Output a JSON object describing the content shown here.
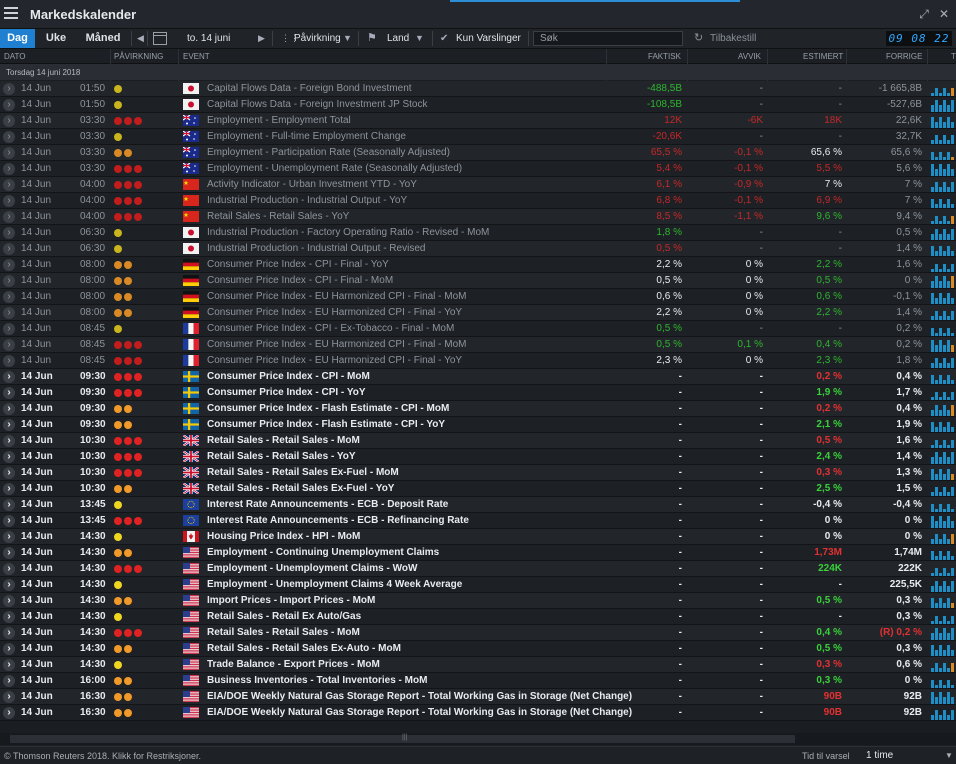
{
  "app": {
    "title": "Markedskalender"
  },
  "toolbar": {
    "tabs": [
      "Dag",
      "Uke",
      "Måned"
    ],
    "date_label": "to. 14 juni",
    "filter_impact": "Påvirkning",
    "filter_country": "Land",
    "alerts_only": "Kun Varslinger",
    "search_placeholder": "Søk",
    "reset": "Tilbakestill",
    "clock": "09 08 22"
  },
  "columns": {
    "date": "DATO",
    "impact": "PÅVIRKNING",
    "event": "EVENT",
    "actual": "FAKTISK",
    "deviation": "AVVIK",
    "estimate": "ESTIMERT",
    "previous": "FORRIGE",
    "trend": "T"
  },
  "group_label": "Torsdag 14 juni 2018",
  "rows": [
    {
      "date": "14 Jun",
      "time": "01:50",
      "impact": "y",
      "country": "JP",
      "event": "Capital Flows Data - Foreign Bond Investment",
      "actual": "-488,5B",
      "ac": "green",
      "dev": "-",
      "dc": "",
      "est": "-",
      "ec": "",
      "prev": "-1 665,8B",
      "state": "past"
    },
    {
      "date": "14 Jun",
      "time": "01:50",
      "impact": "y",
      "country": "JP",
      "event": "Capital Flows Data - Foreign Investment JP Stock",
      "actual": "-108,5B",
      "ac": "green",
      "dev": "-",
      "dc": "",
      "est": "-",
      "ec": "",
      "prev": "-527,6B",
      "state": "past"
    },
    {
      "date": "14 Jun",
      "time": "03:30",
      "impact": "rrr",
      "country": "AU",
      "event": "Employment - Employment Total",
      "actual": "12K",
      "ac": "red",
      "dev": "-6K",
      "dc": "red",
      "est": "18K",
      "ec": "red",
      "prev": "22,6K",
      "state": "past"
    },
    {
      "date": "14 Jun",
      "time": "03:30",
      "impact": "y",
      "country": "AU",
      "event": "Employment - Full-time Employment Change",
      "actual": "-20,6K",
      "ac": "red",
      "dev": "-",
      "dc": "",
      "est": "-",
      "ec": "",
      "prev": "32,7K",
      "state": "past"
    },
    {
      "date": "14 Jun",
      "time": "03:30",
      "impact": "oo",
      "country": "AU",
      "event": "Employment - Participation Rate (Seasonally Adjusted)",
      "actual": "65,5 %",
      "ac": "red",
      "dev": "-0,1 %",
      "dc": "red",
      "est": "65,6 %",
      "ec": "white",
      "prev": "65,6 %",
      "state": "past"
    },
    {
      "date": "14 Jun",
      "time": "03:30",
      "impact": "rrr",
      "country": "AU",
      "event": "Employment - Unemployment Rate (Seasonally Adjusted)",
      "actual": "5,4 %",
      "ac": "red",
      "dev": "-0,1 %",
      "dc": "red",
      "est": "5,5 %",
      "ec": "red",
      "prev": "5,6 %",
      "state": "past"
    },
    {
      "date": "14 Jun",
      "time": "04:00",
      "impact": "rrr",
      "country": "CN",
      "event": "Activity Indicator - Urban Investment YTD - YoY",
      "actual": "6,1 %",
      "ac": "red",
      "dev": "-0,9 %",
      "dc": "red",
      "est": "7 %",
      "ec": "white",
      "prev": "7 %",
      "state": "past"
    },
    {
      "date": "14 Jun",
      "time": "04:00",
      "impact": "rrr",
      "country": "CN",
      "event": "Industrial Production - Industrial Output - YoY",
      "actual": "6,8 %",
      "ac": "red",
      "dev": "-0,1 %",
      "dc": "red",
      "est": "6,9 %",
      "ec": "red",
      "prev": "7 %",
      "state": "past"
    },
    {
      "date": "14 Jun",
      "time": "04:00",
      "impact": "rrr",
      "country": "CN",
      "event": "Retail Sales - Retail Sales - YoY",
      "actual": "8,5 %",
      "ac": "red",
      "dev": "-1,1 %",
      "dc": "red",
      "est": "9,6 %",
      "ec": "green",
      "prev": "9,4 %",
      "state": "past"
    },
    {
      "date": "14 Jun",
      "time": "06:30",
      "impact": "y",
      "country": "JP",
      "event": "Industrial Production - Factory Operating Ratio - Revised - MoM",
      "actual": "1,8 %",
      "ac": "green",
      "dev": "-",
      "dc": "",
      "est": "-",
      "ec": "",
      "prev": "0,5 %",
      "state": "past"
    },
    {
      "date": "14 Jun",
      "time": "06:30",
      "impact": "y",
      "country": "JP",
      "event": "Industrial Production - Industrial Output - Revised",
      "actual": "0,5 %",
      "ac": "red",
      "dev": "-",
      "dc": "",
      "est": "-",
      "ec": "",
      "prev": "1,4 %",
      "state": "past"
    },
    {
      "date": "14 Jun",
      "time": "08:00",
      "impact": "oo",
      "country": "DE",
      "event": "Consumer Price Index - CPI - Final - YoY",
      "actual": "2,2 %",
      "ac": "white",
      "dev": "0 %",
      "dc": "white",
      "est": "2,2 %",
      "ec": "green",
      "prev": "1,6 %",
      "state": "past"
    },
    {
      "date": "14 Jun",
      "time": "08:00",
      "impact": "oo",
      "country": "DE",
      "event": "Consumer Price Index - CPI - Final - MoM",
      "actual": "0,5 %",
      "ac": "white",
      "dev": "0 %",
      "dc": "white",
      "est": "0,5 %",
      "ec": "green",
      "prev": "0 %",
      "state": "past"
    },
    {
      "date": "14 Jun",
      "time": "08:00",
      "impact": "oo",
      "country": "DE",
      "event": "Consumer Price Index - EU Harmonized CPI - Final - MoM",
      "actual": "0,6 %",
      "ac": "white",
      "dev": "0 %",
      "dc": "white",
      "est": "0,6 %",
      "ec": "green",
      "prev": "-0,1 %",
      "state": "past"
    },
    {
      "date": "14 Jun",
      "time": "08:00",
      "impact": "oo",
      "country": "DE",
      "event": "Consumer Price Index - EU Harmonized CPI - Final - YoY",
      "actual": "2,2 %",
      "ac": "white",
      "dev": "0 %",
      "dc": "white",
      "est": "2,2 %",
      "ec": "green",
      "prev": "1,4 %",
      "state": "past"
    },
    {
      "date": "14 Jun",
      "time": "08:45",
      "impact": "y",
      "country": "FR",
      "event": "Consumer Price Index - CPI - Ex-Tobacco - Final - MoM",
      "actual": "0,5 %",
      "ac": "green",
      "dev": "-",
      "dc": "",
      "est": "-",
      "ec": "",
      "prev": "0,2 %",
      "state": "past"
    },
    {
      "date": "14 Jun",
      "time": "08:45",
      "impact": "rrr",
      "country": "FR",
      "event": "Consumer Price Index - EU Harmonized CPI - Final - MoM",
      "actual": "0,5 %",
      "ac": "green",
      "dev": "0,1 %",
      "dc": "green",
      "est": "0,4 %",
      "ec": "green",
      "prev": "0,2 %",
      "state": "past"
    },
    {
      "date": "14 Jun",
      "time": "08:45",
      "impact": "rrr",
      "country": "FR",
      "event": "Consumer Price Index - EU Harmonized CPI - Final - YoY",
      "actual": "2,3 %",
      "ac": "white",
      "dev": "0 %",
      "dc": "white",
      "est": "2,3 %",
      "ec": "green",
      "prev": "1,8 %",
      "state": "past"
    },
    {
      "date": "14 Jun",
      "time": "09:30",
      "impact": "rrr",
      "country": "SE",
      "event": "Consumer Price Index - CPI - MoM",
      "actual": "-",
      "ac": "",
      "dev": "-",
      "dc": "",
      "est": "0,2 %",
      "ec": "red",
      "prev": "0,4 %",
      "state": "future"
    },
    {
      "date": "14 Jun",
      "time": "09:30",
      "impact": "rrr",
      "country": "SE",
      "event": "Consumer Price Index - CPI - YoY",
      "actual": "-",
      "ac": "",
      "dev": "-",
      "dc": "",
      "est": "1,9 %",
      "ec": "green",
      "prev": "1,7 %",
      "state": "future"
    },
    {
      "date": "14 Jun",
      "time": "09:30",
      "impact": "oo",
      "country": "SE",
      "event": "Consumer Price Index - Flash Estimate - CPI - MoM",
      "actual": "-",
      "ac": "",
      "dev": "-",
      "dc": "",
      "est": "0,2 %",
      "ec": "red",
      "prev": "0,4 %",
      "state": "future"
    },
    {
      "date": "14 Jun",
      "time": "09:30",
      "impact": "oo",
      "country": "SE",
      "event": "Consumer Price Index - Flash Estimate - CPI - YoY",
      "actual": "-",
      "ac": "",
      "dev": "-",
      "dc": "",
      "est": "2,1 %",
      "ec": "green",
      "prev": "1,9 %",
      "state": "future"
    },
    {
      "date": "14 Jun",
      "time": "10:30",
      "impact": "rrr",
      "country": "GB",
      "event": "Retail Sales - Retail Sales - MoM",
      "actual": "-",
      "ac": "",
      "dev": "-",
      "dc": "",
      "est": "0,5 %",
      "ec": "red",
      "prev": "1,6 %",
      "state": "future"
    },
    {
      "date": "14 Jun",
      "time": "10:30",
      "impact": "rrr",
      "country": "GB",
      "event": "Retail Sales - Retail Sales - YoY",
      "actual": "-",
      "ac": "",
      "dev": "-",
      "dc": "",
      "est": "2,4 %",
      "ec": "green",
      "prev": "1,4 %",
      "state": "future"
    },
    {
      "date": "14 Jun",
      "time": "10:30",
      "impact": "rrr",
      "country": "GB",
      "event": "Retail Sales - Retail Sales Ex-Fuel - MoM",
      "actual": "-",
      "ac": "",
      "dev": "-",
      "dc": "",
      "est": "0,3 %",
      "ec": "red",
      "prev": "1,3 %",
      "state": "future"
    },
    {
      "date": "14 Jun",
      "time": "10:30",
      "impact": "oo",
      "country": "GB",
      "event": "Retail Sales - Retail Sales Ex-Fuel - YoY",
      "actual": "-",
      "ac": "",
      "dev": "-",
      "dc": "",
      "est": "2,5 %",
      "ec": "green",
      "prev": "1,5 %",
      "state": "future"
    },
    {
      "date": "14 Jun",
      "time": "13:45",
      "impact": "y",
      "country": "EU",
      "event": "Interest Rate Announcements - ECB - Deposit Rate",
      "actual": "-",
      "ac": "",
      "dev": "-",
      "dc": "",
      "est": "-0,4 %",
      "ec": "white",
      "prev": "-0,4 %",
      "state": "future"
    },
    {
      "date": "14 Jun",
      "time": "13:45",
      "impact": "rrr",
      "country": "EU",
      "event": "Interest Rate Announcements - ECB - Refinancing Rate",
      "actual": "-",
      "ac": "",
      "dev": "-",
      "dc": "",
      "est": "0 %",
      "ec": "white",
      "prev": "0 %",
      "state": "future"
    },
    {
      "date": "14 Jun",
      "time": "14:30",
      "impact": "y",
      "country": "CA",
      "event": "Housing Price Index - HPI - MoM",
      "actual": "-",
      "ac": "",
      "dev": "-",
      "dc": "",
      "est": "0 %",
      "ec": "white",
      "prev": "0 %",
      "state": "future"
    },
    {
      "date": "14 Jun",
      "time": "14:30",
      "impact": "oo",
      "country": "US",
      "event": "Employment - Continuing Unemployment Claims",
      "actual": "-",
      "ac": "",
      "dev": "-",
      "dc": "",
      "est": "1,73M",
      "ec": "red",
      "prev": "1,74M",
      "state": "future"
    },
    {
      "date": "14 Jun",
      "time": "14:30",
      "impact": "rrr",
      "country": "US",
      "event": "Employment - Unemployment Claims - WoW",
      "actual": "-",
      "ac": "",
      "dev": "-",
      "dc": "",
      "est": "224K",
      "ec": "green",
      "prev": "222K",
      "state": "future"
    },
    {
      "date": "14 Jun",
      "time": "14:30",
      "impact": "y",
      "country": "US",
      "event": "Employment - Unemployment Claims 4 Week Average",
      "actual": "-",
      "ac": "",
      "dev": "-",
      "dc": "",
      "est": "-",
      "ec": "",
      "prev": "225,5K",
      "state": "future"
    },
    {
      "date": "14 Jun",
      "time": "14:30",
      "impact": "oo",
      "country": "US",
      "event": "Import Prices - Import Prices - MoM",
      "actual": "-",
      "ac": "",
      "dev": "-",
      "dc": "",
      "est": "0,5 %",
      "ec": "green",
      "prev": "0,3 %",
      "state": "future"
    },
    {
      "date": "14 Jun",
      "time": "14:30",
      "impact": "y",
      "country": "US",
      "event": "Retail Sales - Retail Ex Auto/Gas",
      "actual": "-",
      "ac": "",
      "dev": "-",
      "dc": "",
      "est": "-",
      "ec": "",
      "prev": "0,3 %",
      "state": "future"
    },
    {
      "date": "14 Jun",
      "time": "14:30",
      "impact": "rrr",
      "country": "US",
      "event": "Retail Sales - Retail Sales - MoM",
      "actual": "-",
      "ac": "",
      "dev": "-",
      "dc": "",
      "est": "0,4 %",
      "ec": "green",
      "prev": "(R) 0,2 %",
      "state": "future"
    },
    {
      "date": "14 Jun",
      "time": "14:30",
      "impact": "oo",
      "country": "US",
      "event": "Retail Sales - Retail Sales Ex-Auto - MoM",
      "actual": "-",
      "ac": "",
      "dev": "-",
      "dc": "",
      "est": "0,5 %",
      "ec": "green",
      "prev": "0,3 %",
      "state": "future"
    },
    {
      "date": "14 Jun",
      "time": "14:30",
      "impact": "y",
      "country": "US",
      "event": "Trade Balance - Export Prices - MoM",
      "actual": "-",
      "ac": "",
      "dev": "-",
      "dc": "",
      "est": "0,3 %",
      "ec": "red",
      "prev": "0,6 %",
      "state": "future"
    },
    {
      "date": "14 Jun",
      "time": "16:00",
      "impact": "oo",
      "country": "US",
      "event": "Business Inventories - Total Inventories - MoM",
      "actual": "-",
      "ac": "",
      "dev": "-",
      "dc": "",
      "est": "0,3 %",
      "ec": "green",
      "prev": "0 %",
      "state": "future"
    },
    {
      "date": "14 Jun",
      "time": "16:30",
      "impact": "oo",
      "country": "US",
      "event": "EIA/DOE Weekly Natural Gas Storage Report - Total Working Gas in Storage (Net Change)",
      "actual": "-",
      "ac": "",
      "dev": "-",
      "dc": "",
      "est": "90B",
      "ec": "red",
      "prev": "92B",
      "state": "future"
    },
    {
      "date": "14 Jun",
      "time": "16:30",
      "impact": "oo",
      "country": "US",
      "event": "EIA/DOE Weekly Natural Gas Storage Report - Total Working Gas in Storage (Net Change)",
      "actual": "-",
      "ac": "",
      "dev": "-",
      "dc": "",
      "est": "90B",
      "ec": "red",
      "prev": "92B",
      "state": "future"
    }
  ],
  "status": {
    "copyright": "© Thomson Reuters 2018. Klikk for Restriksjoner.",
    "alert_label": "Tid til varsel",
    "alert_value": "1 time"
  },
  "colors": {
    "accent": "#1f7fd0",
    "positive": "#39d03a",
    "negative": "#e23030"
  }
}
